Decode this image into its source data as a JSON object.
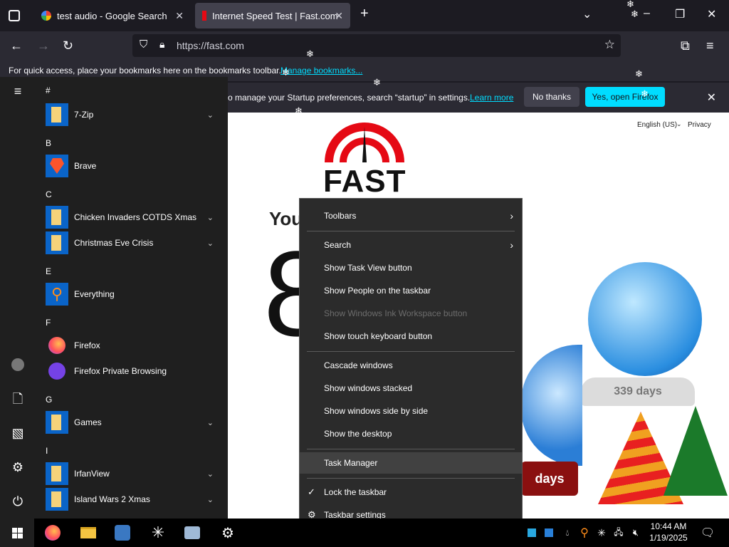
{
  "browser": {
    "tabs": [
      {
        "title": "test audio - Google Search"
      },
      {
        "title": "Internet Speed Test | Fast.com"
      }
    ],
    "url": "https://fast.com",
    "bookmarks_text": "For quick access, place your bookmarks here on the bookmarks toolbar.",
    "bookmarks_link": "Manage bookmarks...",
    "notification": {
      "text": "o manage your Startup preferences, search “startup” in settings.",
      "learn_more": "Learn more",
      "no_thanks": "No thanks",
      "yes": "Yes, open Firefox"
    }
  },
  "page": {
    "language": "English (US)",
    "privacy": "Privacy",
    "logo_text": "FAST",
    "headline_partial": "You",
    "speed_partial": "8",
    "globe_days": "339 days",
    "sign_days": "days"
  },
  "start_menu": {
    "sections": [
      {
        "letter": "#",
        "apps": [
          {
            "name": "7-Zip",
            "type": "folder",
            "expand": true
          }
        ]
      },
      {
        "letter": "B",
        "apps": [
          {
            "name": "Brave",
            "type": "brave",
            "expand": false
          }
        ]
      },
      {
        "letter": "C",
        "apps": [
          {
            "name": "Chicken Invaders COTDS Xmas",
            "type": "folder",
            "expand": true
          },
          {
            "name": "Christmas Eve Crisis",
            "type": "folder",
            "expand": true
          }
        ]
      },
      {
        "letter": "E",
        "apps": [
          {
            "name": "Everything",
            "type": "everything",
            "expand": false
          }
        ]
      },
      {
        "letter": "F",
        "apps": [
          {
            "name": "Firefox",
            "type": "firefox",
            "expand": false
          },
          {
            "name": "Firefox Private Browsing",
            "type": "firefox-private",
            "expand": false
          }
        ]
      },
      {
        "letter": "G",
        "apps": [
          {
            "name": "Games",
            "type": "folder",
            "expand": true
          }
        ]
      },
      {
        "letter": "I",
        "apps": [
          {
            "name": "IrfanView",
            "type": "folder",
            "expand": true
          },
          {
            "name": "Island Wars 2 Xmas",
            "type": "folder",
            "expand": true
          }
        ]
      }
    ]
  },
  "context_menu": {
    "items": [
      {
        "label": "Toolbars",
        "submenu": true
      },
      {
        "label": "Search",
        "submenu": true
      },
      {
        "label": "Show Task View button"
      },
      {
        "label": "Show People on the taskbar"
      },
      {
        "label": "Show Windows Ink Workspace button",
        "disabled": true
      },
      {
        "label": "Show touch keyboard button"
      },
      {
        "label": "Cascade windows"
      },
      {
        "label": "Show windows stacked"
      },
      {
        "label": "Show windows side by side"
      },
      {
        "label": "Show the desktop"
      },
      {
        "label": "Task Manager",
        "highlighted": true
      },
      {
        "label": "Lock the taskbar",
        "checked": true
      },
      {
        "label": "Taskbar settings",
        "icon": "gear"
      }
    ]
  },
  "taskbar": {
    "time": "10:44 AM",
    "date": "1/19/2025"
  },
  "colors": {
    "accent": "#00ddff",
    "fast_red": "#e50914"
  }
}
